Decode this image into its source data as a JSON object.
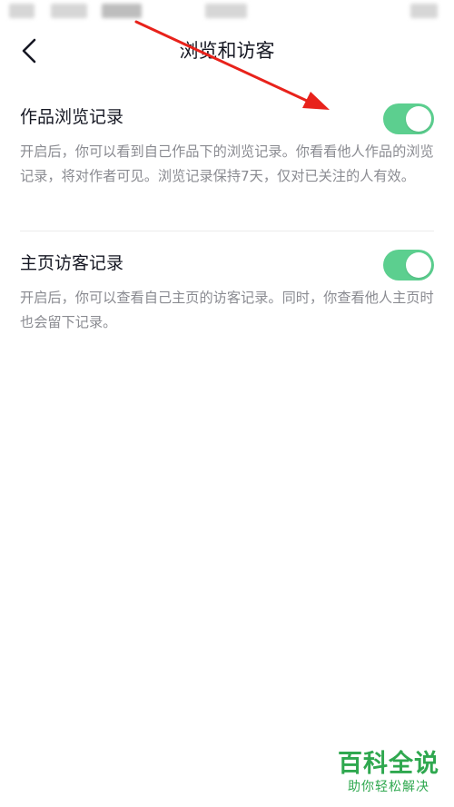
{
  "nav": {
    "title": "浏览和访客"
  },
  "settings": [
    {
      "title": "作品浏览记录",
      "description": "开启后，你可以看到自己作品下的浏览记录。你看看他人作品的浏览记录，将对作者可见。浏览记录保持7天，仅对已关注的人有效。",
      "enabled": true
    },
    {
      "title": "主页访客记录",
      "description": "开启后，你可以查看自己主页的访客记录。同时，你查看他人主页时也会留下记录。",
      "enabled": true
    }
  ],
  "colors": {
    "toggle_on": "#5ccf8f",
    "annotation_arrow": "#e8221b",
    "watermark": "#2fa84f"
  },
  "watermark": {
    "title": "百科全说",
    "subtitle": "助你轻松解决"
  }
}
